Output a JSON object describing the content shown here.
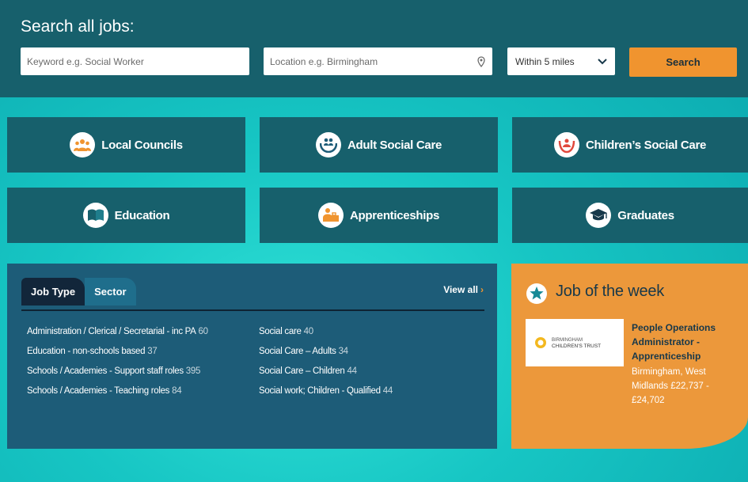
{
  "search": {
    "title": "Search all jobs:",
    "keyword_placeholder": "Keyword e.g. Social Worker",
    "location_placeholder": "Location e.g. Birmingham",
    "radius_value": "Within 5 miles",
    "button_label": "Search"
  },
  "categories": [
    {
      "label": "Local Councils",
      "icon": "people-group-icon"
    },
    {
      "label": "Adult Social Care",
      "icon": "care-hands-icon"
    },
    {
      "label": "Children’s Social Care",
      "icon": "child-care-icon"
    },
    {
      "label": "Education",
      "icon": "book-icon"
    },
    {
      "label": "Apprenticeships",
      "icon": "apprentice-icon"
    },
    {
      "label": "Graduates",
      "icon": "graduation-cap-icon"
    }
  ],
  "browse": {
    "tabs": [
      {
        "label": "Job Type",
        "active": true
      },
      {
        "label": "Sector",
        "active": false
      }
    ],
    "view_all": "View all",
    "left": [
      {
        "label": "Administration / Clerical / Secretarial - inc PA",
        "count": "60"
      },
      {
        "label": "Education - non-schools based",
        "count": "37"
      },
      {
        "label": "Schools / Academies - Support staff roles",
        "count": "395"
      },
      {
        "label": "Schools / Academies - Teaching roles",
        "count": "84"
      }
    ],
    "right": [
      {
        "label": "Social care",
        "count": "40"
      },
      {
        "label": "Social Care – Adults",
        "count": "34"
      },
      {
        "label": "Social Care – Children",
        "count": "44"
      },
      {
        "label": "Social work; Children - Qualified",
        "count": "44"
      }
    ]
  },
  "job_of_week": {
    "heading": "Job of the week",
    "logo_line1": "BIRMINGHAM",
    "logo_line2": "CHILDREN'S TRUST",
    "title": "People Operations Administrator - Apprenticeship",
    "meta": "Birmingham, West Midlands £22,737 - £24,702"
  },
  "colors": {
    "teal_dark": "#17606c",
    "accent_orange": "#f0942f",
    "panel_blue": "#1d5c78"
  }
}
